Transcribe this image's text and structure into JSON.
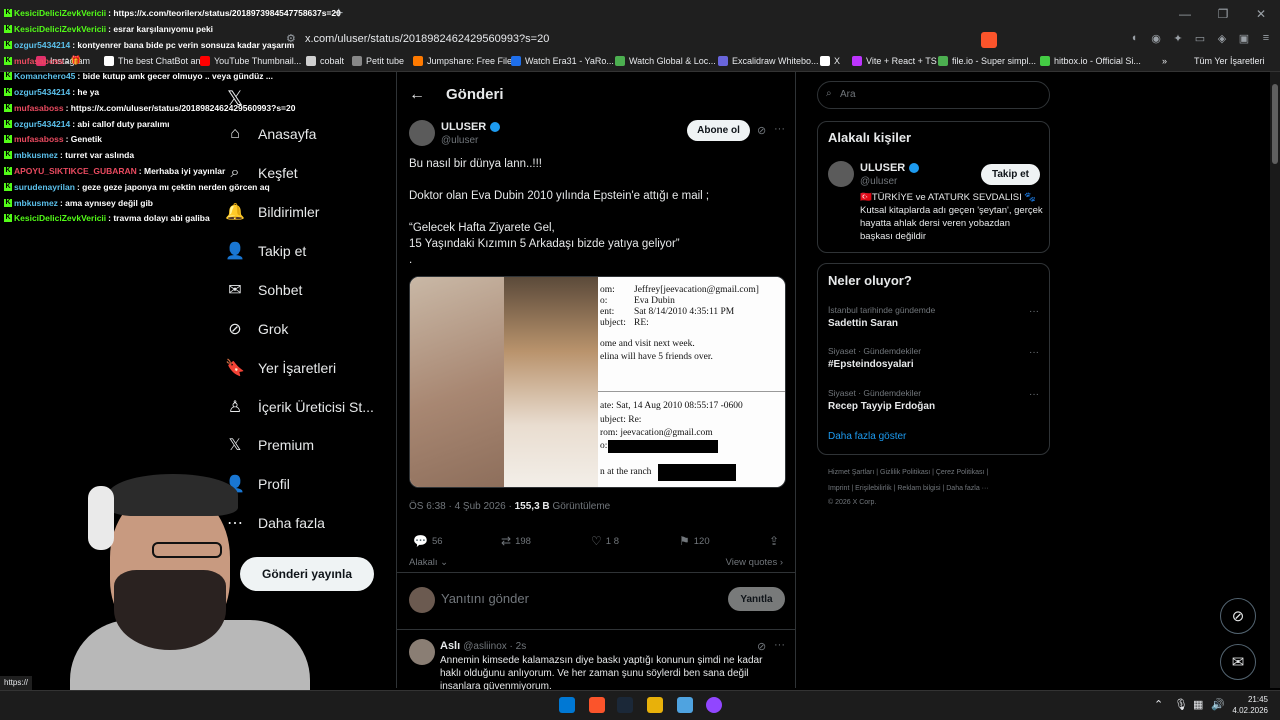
{
  "browser": {
    "url": "x.com/uluser/status/2018982462429560993?s=20",
    "win_controls": [
      "—",
      "❐",
      "✕"
    ],
    "new_tab": "+",
    "bookmarks": [
      {
        "label": "Instagram",
        "color": "#e1306c"
      },
      {
        "label": "The best ChatBot an...",
        "color": "#ffffff"
      },
      {
        "label": "YouTube Thumbnail...",
        "color": "#ff0000"
      },
      {
        "label": "cobalt",
        "color": "#cfcfcf"
      },
      {
        "label": "Petit tube",
        "color": "#888888"
      },
      {
        "label": "Jumpshare: Free File...",
        "color": "#ff7a00"
      },
      {
        "label": "Watch Era31 - YaRo...",
        "color": "#1f6feb"
      },
      {
        "label": "Watch Global & Loc...",
        "color": "#4caf50"
      },
      {
        "label": "Excalidraw Whitebo...",
        "color": "#6965db"
      },
      {
        "label": "X",
        "color": "#ffffff"
      },
      {
        "label": "Vite + React + TS",
        "color": "#bd34fe"
      },
      {
        "label": "file.io - Super simpl...",
        "color": "#4caf50"
      },
      {
        "label": "hitbox.io - Official Si...",
        "color": "#44cc44"
      }
    ],
    "bookmarks_more": "»",
    "all_bookmarks": "Tüm Yer İşaretleri",
    "status_url": "https://"
  },
  "chat": [
    {
      "user": "KesiciDeliciZevkVericii",
      "color": "#53fc18",
      "text": ": https://x.com/teorilerx/status/2018973984547758637s=20"
    },
    {
      "user": "KesiciDeliciZevkVericii",
      "color": "#53fc18",
      "text": ": esrar karşılanıyomu peki"
    },
    {
      "user": "ozgur5434214",
      "color": "#5bc0eb",
      "text": ": kontyenrer bana bide pc verin sonsuza kadar yaşarım"
    },
    {
      "user": "mufasaboss",
      "color": "#e84a5f",
      "text": ": 🎁"
    },
    {
      "user": "Komanchero45",
      "color": "#5bc0eb",
      "text": ": bide kutup amk gecer olmuyo .. veya gündüz ..."
    },
    {
      "user": "ozgur5434214",
      "color": "#5bc0eb",
      "text": ": he ya"
    },
    {
      "user": "mufasaboss",
      "color": "#e84a5f",
      "text": ": https://x.com/uluser/status/2018982462429560993?s=20"
    },
    {
      "user": "ozgur5434214",
      "color": "#5bc0eb",
      "text": ": abi callof duty paralımı"
    },
    {
      "user": "mufasaboss",
      "color": "#e84a5f",
      "text": ": Genetik"
    },
    {
      "user": "mbkusmez",
      "color": "#5bc0eb",
      "text": ": turret var aslında"
    },
    {
      "user": "APOYU_SIKTIKCE_GUBARAN",
      "color": "#e84a5f",
      "text": ": Merhaba iyi yayınlar"
    },
    {
      "user": "surudenayrilan",
      "color": "#5bc0eb",
      "text": ": geze geze japonya mı çektin nerden görcen aq"
    },
    {
      "user": "mbkusmez",
      "color": "#5bc0eb",
      "text": ": ama aynısey değil gib"
    },
    {
      "user": "KesiciDeliciZevkVericii",
      "color": "#53fc18",
      "text": ": travma dolayı abi galiba"
    }
  ],
  "nav": {
    "logo": "𝕏",
    "items": [
      {
        "label": "Anasayfa",
        "icon": "⌂"
      },
      {
        "label": "Keşfet",
        "icon": "⌕"
      },
      {
        "label": "Bildirimler",
        "icon": "🔔"
      },
      {
        "label": "Takip et",
        "icon": "👤"
      },
      {
        "label": "Sohbet",
        "icon": "✉"
      },
      {
        "label": "Grok",
        "icon": "⊘"
      },
      {
        "label": "Yer İşaretleri",
        "icon": "🔖"
      },
      {
        "label": "İçerik Üreticisi St...",
        "icon": "♙"
      },
      {
        "label": "Premium",
        "icon": "𝕏"
      },
      {
        "label": "Profil",
        "icon": "👤"
      },
      {
        "label": "Daha fazla",
        "icon": "⋯"
      }
    ],
    "post_button": "Gönderi yayınla"
  },
  "post": {
    "back_arrow": "←",
    "header": "Gönderi",
    "name": "ULUSER",
    "handle": "@uluser",
    "follow": "Abone ol",
    "more": "···",
    "lines": [
      "Bu nasıl bir dünya lann..!!!",
      "Doktor olan Eva Dubin 2010 yılında Epstein'e attığı e mail ;",
      "“Gelecek Hafta Ziyarete Gel,",
      "15 Yaşındaki Kızımın 5 Arkadaşı bizde yatıya geliyor”",
      "."
    ],
    "email": {
      "from_label": "om:",
      "from": "Jeffrey[jeevacation@gmail.com]",
      "to_label": "o:",
      "to": "Eva Dubin",
      "sent_label": "ent:",
      "sent": "Sat 8/14/2010 4:35:11 PM",
      "subject_label": "ubject:",
      "subject": "RE:",
      "body1": "ome and visit next week.",
      "body2": "elina will have 5 friends over.",
      "date2": "ate: Sat, 14 Aug 2010 08:55:17 -0600",
      "subject2": "ubject: Re:",
      "from2": "rom: jeevacation@gmail.com",
      "to2": "o:",
      "ranch": "n at the ranch"
    },
    "time": "ÖS 6:38 · 4 Şub 2026 ·",
    "views": "155,3 B",
    "views_label": "Görüntüleme",
    "replies": "56",
    "reposts": "198",
    "likes": "1 8",
    "bookmarks": "120",
    "relevant": "Alakalı",
    "view_quotes": "View quotes ›",
    "reply_placeholder": "Yanıtını gönder",
    "reply_button": "Yanıtla"
  },
  "comment": {
    "name": "Aslı",
    "handle": "@asliinox · 2s",
    "lines": [
      "Annemin kimsede kalamazsın diye baskı yaptığı konunun şimdi ne kadar",
      "haklı olduğunu anlıyorum. Ve her zaman şunu söylerdi ben sana değil",
      "insanlara güvenmiyorum."
    ]
  },
  "sidebar": {
    "search_placeholder": "Ara",
    "related_title": "Alakalı kişiler",
    "related_name": "ULUSER",
    "related_handle": "@uluser",
    "follow": "Takip et",
    "bio": "🇹🇷TÜRKİYE ve ATATURK SEVDALISI 🐾 Kutsal kitaplarda adı geçen 'şeytan', gerçek hayatta ahlak dersi veren yobazdan başkası değildir",
    "trends_title": "Neler oluyor?",
    "trends": [
      {
        "sub": "İstanbul tarihinde gündemde",
        "main": "Sadettin Saran"
      },
      {
        "sub": "Siyaset · Gündemdekiler",
        "main": "#Epsteindosyalari"
      },
      {
        "sub": "Siyaset · Gündemdekiler",
        "main": "Recep Tayyip Erdoğan"
      }
    ],
    "show_more": "Daha fazla göster",
    "footer1": "Hizmet Şartları  |  Gizlilik Politikası  |  Çerez Politikası  |",
    "footer2": "Imprint  |  Erişilebilirlik  |  Reklam bilgisi  |  Daha fazla ···",
    "footer3": "© 2026 X Corp."
  },
  "taskbar": {
    "time": "21:45",
    "date": "4.02.2026"
  }
}
